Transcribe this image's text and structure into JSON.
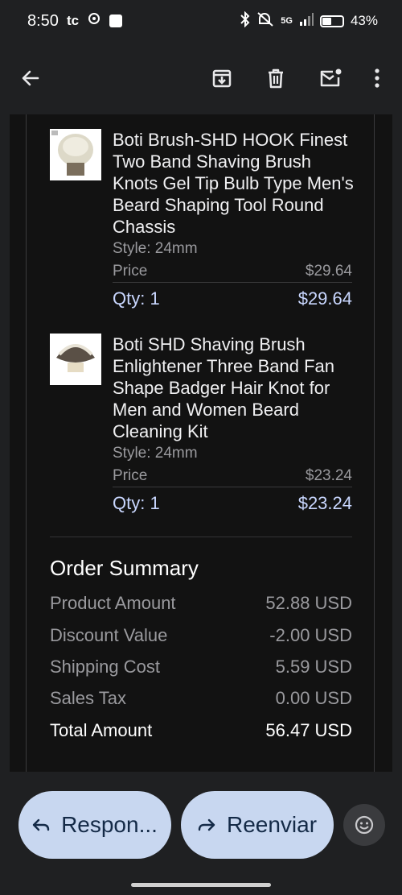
{
  "status_bar": {
    "time": "8:50",
    "carrier": "tc",
    "network": "5G",
    "battery": "43%"
  },
  "app_bar": {
    "back_icon": "arrow-left-icon",
    "archive_icon": "archive-icon",
    "delete_icon": "trash-icon",
    "unread_icon": "mail-unread-icon",
    "more_icon": "more-vertical-icon"
  },
  "items": [
    {
      "title": "Boti Brush-SHD HOOK Finest Two Band Shaving Brush Knots Gel Tip Bulb Type Men's Beard Shaping Tool Round Chassis",
      "style": "Style: 24mm",
      "price_label": "Price",
      "price": "$29.64",
      "qty": "Qty: 1",
      "total": "$29.64"
    },
    {
      "title": "Boti SHD Shaving Brush Enlightener Three Band Fan Shape Badger Hair Knot for Men and Women Beard Cleaning Kit",
      "style": "Style: 24mm",
      "price_label": "Price",
      "price": "$23.24",
      "qty": "Qty: 1",
      "total": "$23.24"
    }
  ],
  "summary": {
    "title": "Order Summary",
    "rows": [
      {
        "label": "Product Amount",
        "value": "52.88 USD"
      },
      {
        "label": "Discount Value",
        "value": "-2.00 USD"
      },
      {
        "label": "Shipping Cost",
        "value": "5.59 USD"
      },
      {
        "label": "Sales Tax",
        "value": "0.00 USD"
      }
    ],
    "total_label": "Total Amount",
    "total_value": "56.47 USD"
  },
  "actions": {
    "reply_label": "Respon...",
    "forward_label": "Reenviar"
  },
  "colors": {
    "background": "#1f2022",
    "card": "#121212",
    "accent_text": "#c9d7ff",
    "pill": "#c8d7f0"
  }
}
